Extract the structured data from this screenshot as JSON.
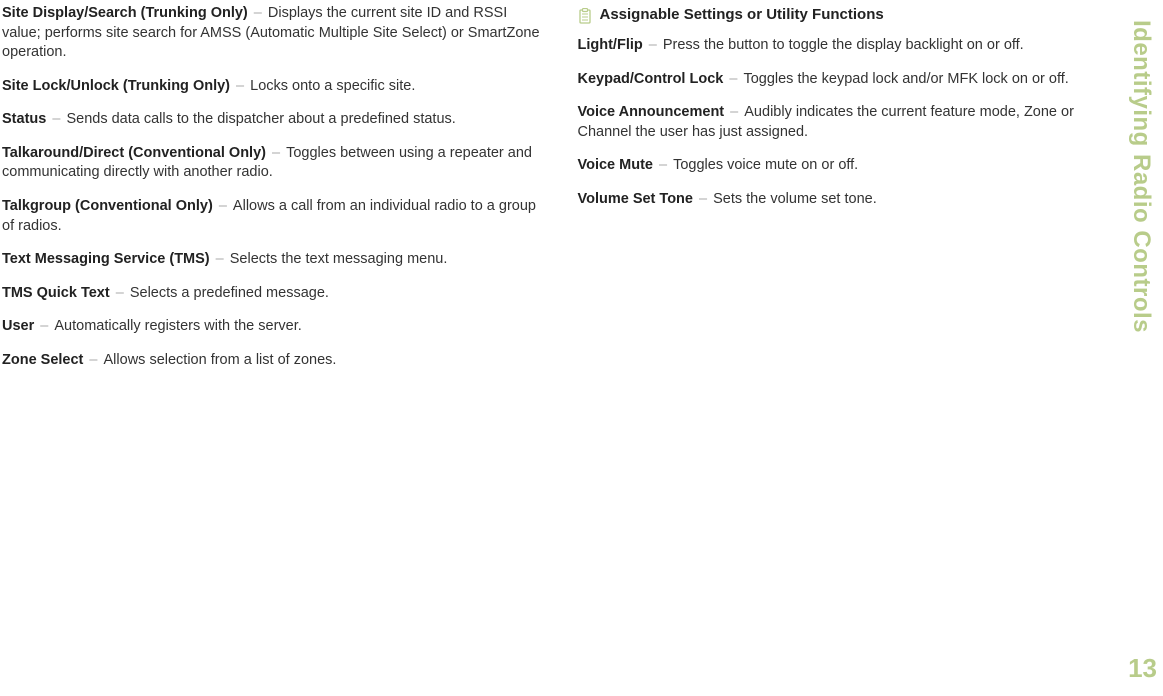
{
  "sideLabel": "Identifying Radio Controls",
  "pageNumber": "13",
  "leftColumn": [
    {
      "term": "Site Display/Search (Trunking Only)",
      "desc": "Displays the current site ID and RSSI value; performs site search for AMSS (Automatic Multiple Site Select) or SmartZone operation."
    },
    {
      "term": "Site Lock/Unlock (Trunking Only)",
      "desc": "Locks onto a specific site."
    },
    {
      "term": "Status",
      "desc": "Sends data calls to the dispatcher about a predefined status."
    },
    {
      "term": "Talkaround/Direct (Conventional Only)",
      "desc": "Toggles between using a repeater and communicating directly with another radio."
    },
    {
      "term": "Talkgroup (Conventional Only)",
      "desc": "Allows a call from an individual radio to a group of radios."
    },
    {
      "term": "Text Messaging Service (TMS)",
      "desc": "Selects the text messaging menu."
    },
    {
      "term": "TMS Quick Text",
      "desc": "Selects a predefined message."
    },
    {
      "term": "User",
      "desc": "Automatically registers with the server."
    },
    {
      "term": "Zone Select",
      "desc": "Allows selection from a list of zones."
    }
  ],
  "rightColumn": {
    "title": "Assignable Settings or Utility Functions",
    "entries": [
      {
        "term": "Light/Flip",
        "desc": "Press the button to toggle the display backlight on or off."
      },
      {
        "term": "Keypad/Control Lock",
        "desc": "Toggles the keypad lock and/or MFK lock on or off."
      },
      {
        "term": "Voice Announcement",
        "desc": "Audibly indicates the current feature mode, Zone or Channel the user has just assigned."
      },
      {
        "term": "Voice Mute",
        "desc": "Toggles voice mute on or off."
      },
      {
        "term": "Volume Set Tone",
        "desc": "Sets the volume set tone."
      }
    ]
  }
}
